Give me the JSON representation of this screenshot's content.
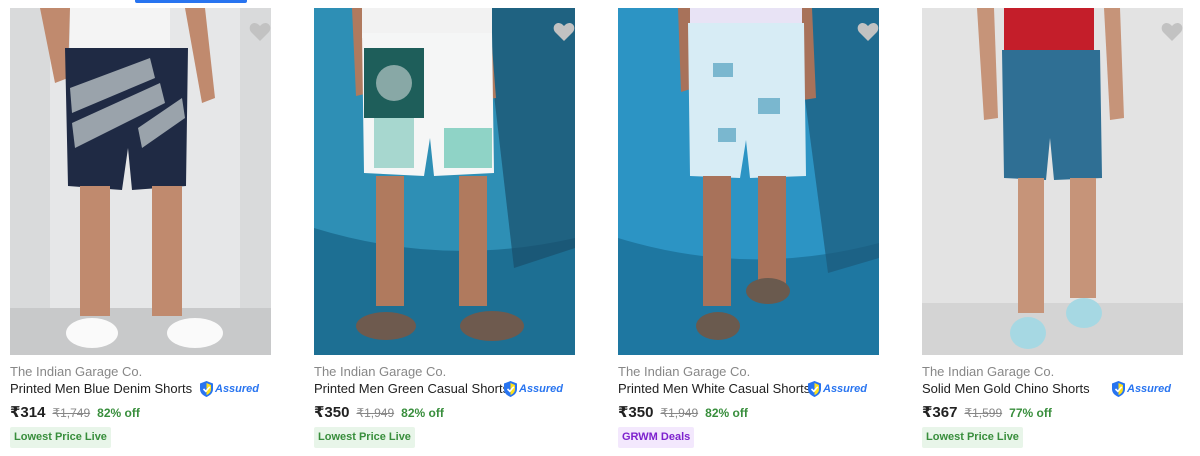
{
  "products": [
    {
      "brand": "The Indian Garage Co.",
      "title": "Printed Men Blue Denim Shorts",
      "assured": "Assured",
      "price": "₹314",
      "mrp": "₹1,749",
      "discount": "82% off",
      "tag": "Lowest Price Live",
      "tag_bg": "#e8f5e9",
      "tag_color": "#388e3c"
    },
    {
      "brand": "The Indian Garage Co.",
      "title": "Printed Men Green Casual Shorts",
      "assured": "Assured",
      "price": "₹350",
      "mrp": "₹1,949",
      "discount": "82% off",
      "tag": "Lowest Price Live",
      "tag_bg": "#e8f5e9",
      "tag_color": "#388e3c"
    },
    {
      "brand": "The Indian Garage Co.",
      "title": "Printed Men White Casual Shorts",
      "assured": "Assured",
      "price": "₹350",
      "mrp": "₹1,949",
      "discount": "82% off",
      "tag": "GRWM Deals",
      "tag_bg": "#f3e8fd",
      "tag_color": "#7e22ce"
    },
    {
      "brand": "The Indian Garage Co.",
      "title": "Solid Men Gold Chino Shorts",
      "assured": "Assured",
      "price": "₹367",
      "mrp": "₹1,599",
      "discount": "77% off",
      "tag": "Lowest Price Live",
      "tag_bg": "#e8f5e9",
      "tag_color": "#388e3c"
    }
  ],
  "colors": {
    "accent": "#2874f0",
    "discount_green": "#388e3c",
    "muted_text": "#878787"
  },
  "icons": {
    "wishlist": "heart-icon",
    "assured": "shield-icon"
  }
}
